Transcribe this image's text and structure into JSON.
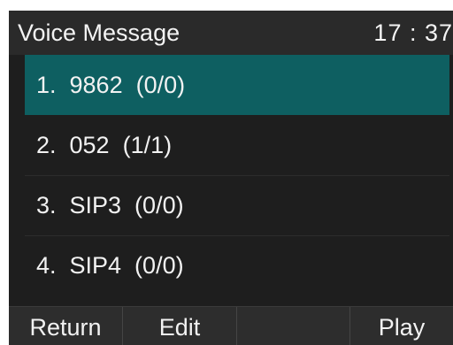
{
  "header": {
    "title": "Voice Message",
    "time": "17 : 37"
  },
  "voicemails": [
    {
      "label": "1.  9862  (0/0)",
      "selected": true
    },
    {
      "label": "2.  052  (1/1)",
      "selected": false
    },
    {
      "label": "3.  SIP3  (0/0)",
      "selected": false
    },
    {
      "label": "4.  SIP4  (0/0)",
      "selected": false
    }
  ],
  "softkeys": {
    "key1": "Return",
    "key2": "Edit",
    "key3": "",
    "key4": "Play"
  },
  "colors": {
    "selected_row": "#0e5f61",
    "background": "#1e1e1e",
    "softkey_bar": "#2d2d2d"
  }
}
